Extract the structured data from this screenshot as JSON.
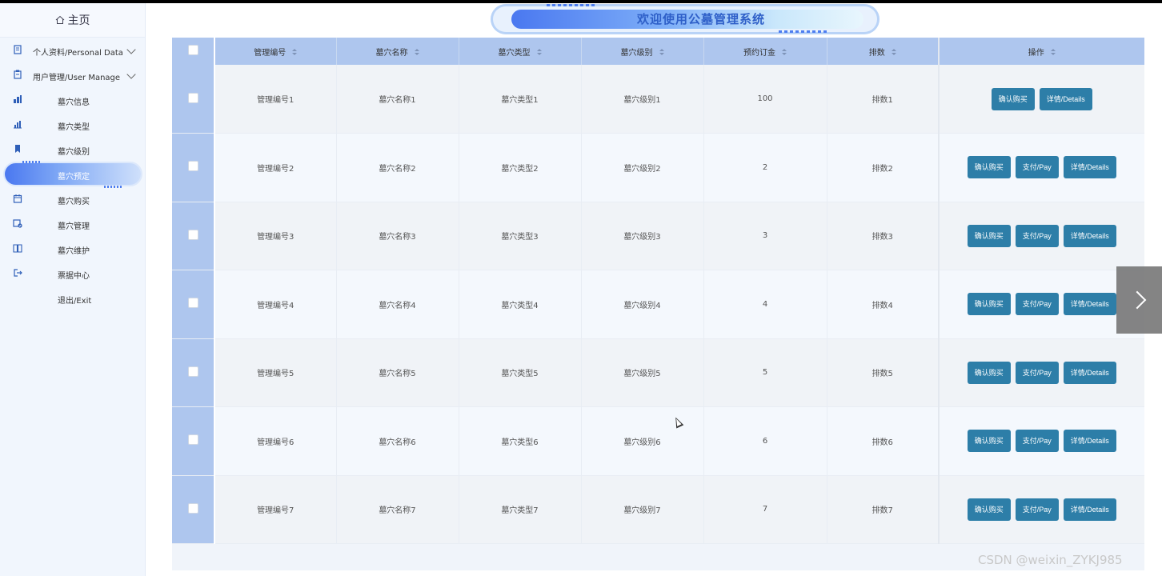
{
  "header": {
    "title": "欢迎使用公墓管理系统"
  },
  "sidebar": {
    "home": "主页",
    "items": [
      {
        "label": "个人资料/Personal Data",
        "icon": "document-icon",
        "expandable": true,
        "sub": false
      },
      {
        "label": "用户管理/User Manage",
        "icon": "clipboard-icon",
        "expandable": true,
        "sub": false
      },
      {
        "label": "墓穴信息",
        "icon": "building-chart-icon",
        "expandable": false,
        "sub": true
      },
      {
        "label": "墓穴类型",
        "icon": "bar-chart-icon",
        "expandable": false,
        "sub": true
      },
      {
        "label": "墓穴级别",
        "icon": "bookmark-icon",
        "expandable": false,
        "sub": true
      },
      {
        "label": "墓穴预定",
        "icon": "",
        "expandable": false,
        "sub": true,
        "active": true
      },
      {
        "label": "墓穴购买",
        "icon": "calendar-icon",
        "expandable": false,
        "sub": true
      },
      {
        "label": "墓穴管理",
        "icon": "calendar-check-icon",
        "expandable": false,
        "sub": true
      },
      {
        "label": "墓穴维护",
        "icon": "book-icon",
        "expandable": false,
        "sub": true
      },
      {
        "label": "票据中心",
        "icon": "logout-icon",
        "expandable": false,
        "sub": true
      },
      {
        "label": "退出/Exit",
        "icon": "",
        "expandable": false,
        "sub": true
      }
    ]
  },
  "table": {
    "columns": [
      "管理编号",
      "墓穴名称",
      "墓穴类型",
      "墓穴级别",
      "预约订金",
      "排数",
      "操作"
    ],
    "rows": [
      {
        "code": "管理编号1",
        "name": "墓穴名称1",
        "type": "墓穴类型1",
        "level": "墓穴级别1",
        "deposit": "100",
        "row": "排数1"
      },
      {
        "code": "管理编号2",
        "name": "墓穴名称2",
        "type": "墓穴类型2",
        "level": "墓穴级别2",
        "deposit": "2",
        "row": "排数2"
      },
      {
        "code": "管理编号3",
        "name": "墓穴名称3",
        "type": "墓穴类型3",
        "level": "墓穴级别3",
        "deposit": "3",
        "row": "排数3"
      },
      {
        "code": "管理编号4",
        "name": "墓穴名称4",
        "type": "墓穴类型4",
        "level": "墓穴级别4",
        "deposit": "4",
        "row": "排数4"
      },
      {
        "code": "管理编号5",
        "name": "墓穴名称5",
        "type": "墓穴类型5",
        "level": "墓穴级别5",
        "deposit": "5",
        "row": "排数5"
      },
      {
        "code": "管理编号6",
        "name": "墓穴名称6",
        "type": "墓穴类型6",
        "level": "墓穴级别6",
        "deposit": "6",
        "row": "排数6"
      },
      {
        "code": "管理编号7",
        "name": "墓穴名称7",
        "type": "墓穴类型7",
        "level": "墓穴级别7",
        "deposit": "7",
        "row": "排数7"
      }
    ],
    "buttons": {
      "confirm": "确认购买",
      "pay": "支付/Pay",
      "details": "详情/Details"
    }
  },
  "watermark": "CSDN @weixin_ZYKJ985",
  "colors": {
    "accent": "#2d7ea8",
    "header_bg": "#aec6ee",
    "sidebar_bg": "#f1f6fd",
    "active_pill": "#4a78f0"
  }
}
